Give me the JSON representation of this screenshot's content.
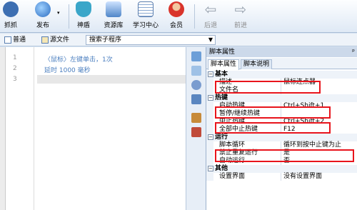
{
  "toolbar": {
    "grab": "抓抓",
    "publish": "发布",
    "shield": "神盾",
    "resources": "资源库",
    "learning": "学习中心",
    "member": "会员",
    "back": "后退",
    "forward": "前进"
  },
  "tabs": {
    "normal": "普通",
    "source": "源文件"
  },
  "subroutine_combo": {
    "value": "搜索子程序"
  },
  "editor": {
    "line_numbers": [
      "1",
      "2",
      "3"
    ],
    "lines": [
      "〈鼠标〉左键单击，1次",
      "延时 1000 毫秒",
      ""
    ]
  },
  "panel": {
    "title": "脚本属性",
    "pin": "ᵖ",
    "tabs": [
      "脚本属性",
      "脚本说明"
    ],
    "rows": [
      {
        "type": "cat",
        "key": "基本",
        "toggle": "−"
      },
      {
        "type": "prop",
        "key": "描述",
        "value": "鼠标连点器"
      },
      {
        "type": "prop",
        "key": "文件名",
        "value": ""
      },
      {
        "type": "cat",
        "key": "热键",
        "toggle": "−"
      },
      {
        "type": "prop",
        "key": "启动热键",
        "value": "Ctrl+Shift+1"
      },
      {
        "type": "prop",
        "key": "暂停/继续热键",
        "value": ""
      },
      {
        "type": "prop",
        "key": "中止热键",
        "value": "Ctrl+Shift+2"
      },
      {
        "type": "prop",
        "key": "全部中止热键",
        "value": "F12"
      },
      {
        "type": "cat",
        "key": "运行",
        "toggle": "−"
      },
      {
        "type": "prop",
        "key": "脚本循环",
        "value": "循环到按中止键为止"
      },
      {
        "type": "prop",
        "key": "禁止重复运行",
        "value": "是"
      },
      {
        "type": "prop",
        "key": "自动运行",
        "value": "否"
      },
      {
        "type": "cat",
        "key": "其他",
        "toggle": "−"
      },
      {
        "type": "prop",
        "key": "设置界面",
        "value": "没有设置界面"
      }
    ]
  },
  "colors": {
    "highlight_box": "#e8141c",
    "code_text": "#4a7ebf"
  }
}
